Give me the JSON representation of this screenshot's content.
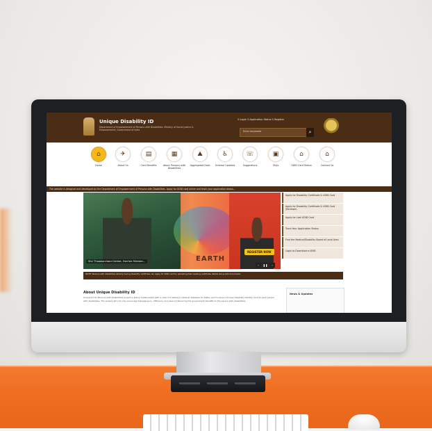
{
  "site": {
    "title": "Unique Disability ID",
    "subtitle": "Department of Empowerment of Persons with Disabilities, Ministry of Social Justice & Empowerment, Government of India",
    "top_links": "⚿ Login   ⚿ Application Status   ⚿ Register",
    "search_placeholder": "Enter keywords"
  },
  "nav": {
    "items": [
      {
        "label": "Home",
        "icon": "⌂",
        "active": true
      },
      {
        "label": "About Us",
        "icon": "✈",
        "active": false
      },
      {
        "label": "Card Benefits",
        "icon": "▤",
        "active": false
      },
      {
        "label": "About Persons with Disabilities",
        "icon": "▦",
        "active": false
      },
      {
        "label": "Aggregated Data",
        "icon": "⛰",
        "active": false
      },
      {
        "label": "Scheme Updates",
        "icon": "♿",
        "active": false
      },
      {
        "label": "Suggestions",
        "icon": "☏",
        "active": false
      },
      {
        "label": "FAQs",
        "icon": "▣",
        "active": false
      },
      {
        "label": "UDID Card Status",
        "icon": "⌂",
        "active": false
      },
      {
        "label": "Contact Us",
        "icon": "⌂",
        "active": false
      }
    ]
  },
  "ticker": "The website is designed and developed by the Department of Empowerment of Persons with Disabilities. Apply for UDID card online and track your application status...",
  "banner": {
    "caption": "Shri Thaawarchand Gehlot, Hon'ble Minister...",
    "earth_text": "EARTH",
    "register_label": "REGISTER NOW",
    "prev": "‹",
    "pause": "❚❚",
    "next": "›"
  },
  "side_menu": [
    "Apply for Disability Certificate & UDID Card",
    "Apply for Disability Certificate & UDID Card (Renewal)",
    "Apply for Lost UDID Card",
    "Track Your Application Status",
    "Find the Medical/Disability Board of Local Area",
    "Login to Download e-UDID"
  ],
  "notice": "NOTE: Persons with disabilities already having disability certificate can apply for UDID card by uploading their existing certificate details along with documents.",
  "about": {
    "title": "About Unique Disability ID",
    "text": "Unique ID for Persons with Disabilities project is being implemented with a view of creating a national database for PwDs, and to issue a Unique Disability Identity Card to each person with disabilities. The project will not only encourage transparency, efficiency and ease of delivering the government benefits to the person with disabilities."
  },
  "news": {
    "title": "News & Updates"
  }
}
